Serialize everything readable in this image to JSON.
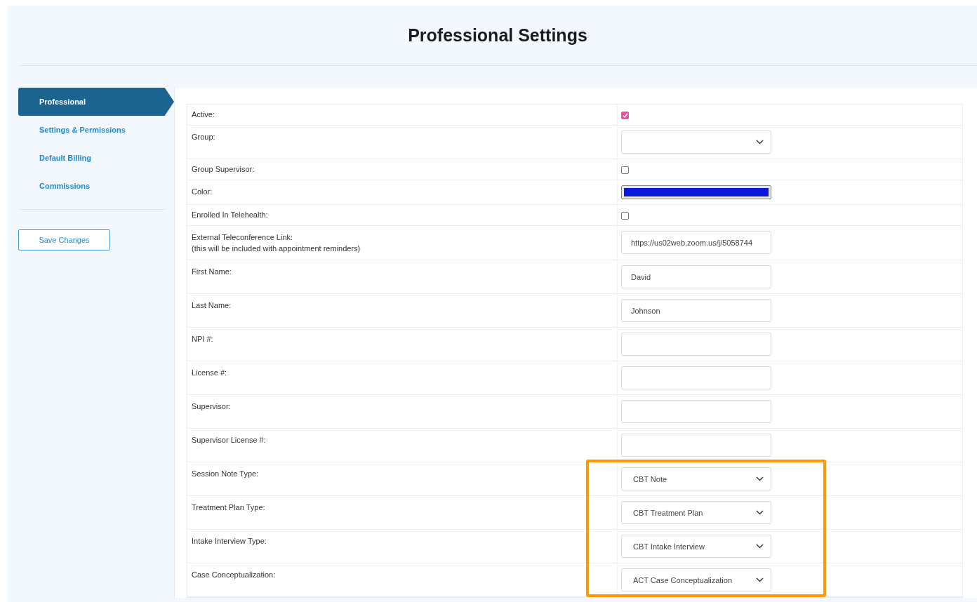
{
  "page": {
    "title": "Professional Settings"
  },
  "sidebar": {
    "items": [
      {
        "label": "Professional",
        "selected": true
      },
      {
        "label": "Settings & Permissions",
        "selected": false
      },
      {
        "label": "Default Billing",
        "selected": false
      },
      {
        "label": "Commissions",
        "selected": false
      }
    ],
    "save_button": "Save Changes"
  },
  "form": {
    "rows": [
      {
        "label": "Active:",
        "kind": "checkbox",
        "checked": true
      },
      {
        "label": "Group:",
        "kind": "select",
        "value": ""
      },
      {
        "label": "Group Supervisor:",
        "kind": "checkbox",
        "checked": false
      },
      {
        "label": "Color:",
        "kind": "color",
        "color": "#0a18dc"
      },
      {
        "label": "Enrolled In Telehealth:",
        "kind": "checkbox",
        "checked": false
      },
      {
        "label": "External Teleconference Link:",
        "note": "(this will be included with appointment reminders)",
        "kind": "text",
        "value": "https://us02web.zoom.us/j/5058744"
      },
      {
        "label": "First Name:",
        "kind": "text",
        "value": "David"
      },
      {
        "label": "Last Name:",
        "kind": "text",
        "value": "Johnson"
      },
      {
        "label": "NPI #:",
        "kind": "text",
        "value": ""
      },
      {
        "label": "License #:",
        "kind": "text",
        "value": ""
      },
      {
        "label": "Supervisor:",
        "kind": "text",
        "value": ""
      },
      {
        "label": "Supervisor License #:",
        "kind": "text",
        "value": ""
      },
      {
        "label": "Session Note Type:",
        "kind": "select",
        "value": "CBT Note",
        "highlighted": true
      },
      {
        "label": "Treatment Plan Type:",
        "kind": "select",
        "value": "CBT Treatment Plan",
        "highlighted": true
      },
      {
        "label": "Intake Interview Type:",
        "kind": "select",
        "value": "CBT Intake Interview",
        "highlighted": true
      },
      {
        "label": "Case Conceptualization:",
        "kind": "select",
        "value": "ACT Case Conceptualization",
        "highlighted": true
      }
    ]
  }
}
